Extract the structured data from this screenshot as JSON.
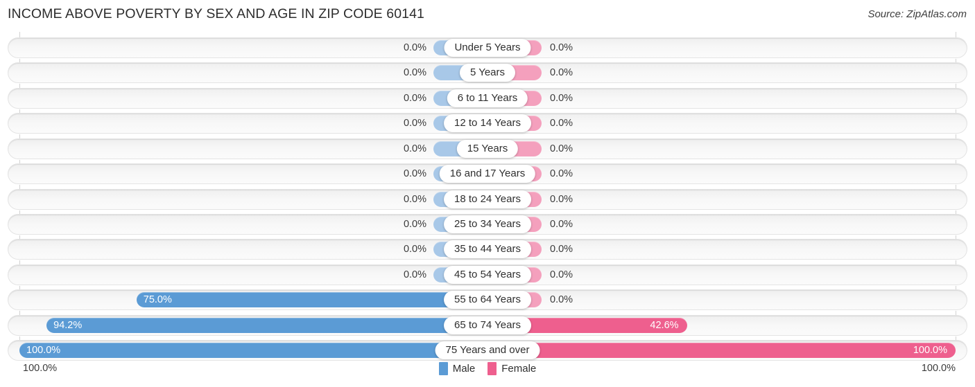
{
  "header": {
    "title": "INCOME ABOVE POVERTY BY SEX AND AGE IN ZIP CODE 60141",
    "source": "Source: ZipAtlas.com"
  },
  "colors": {
    "male": "#5b9bd5",
    "female": "#ee5f8e",
    "male_zero": "#a8c8e8",
    "female_zero": "#f4a0bd",
    "track": "#f7f7f7",
    "gridline": "#d2d2d2"
  },
  "axis": {
    "left_end": "100.0%",
    "right_end": "100.0%",
    "max": 100
  },
  "legend": [
    {
      "label": "Male",
      "color": "#5b9bd5"
    },
    {
      "label": "Female",
      "color": "#ee5f8e"
    }
  ],
  "chart_data": {
    "type": "bar",
    "title": "INCOME ABOVE POVERTY BY SEX AND AGE IN ZIP CODE 60141",
    "subtitle": "Source: ZipAtlas.com",
    "orientation": "horizontal-diverging",
    "xlabel": "",
    "ylabel": "",
    "xlim": [
      0,
      100
    ],
    "grid": true,
    "legend_position": "bottom-center",
    "categories": [
      "Under 5 Years",
      "5 Years",
      "6 to 11 Years",
      "12 to 14 Years",
      "15 Years",
      "16 and 17 Years",
      "18 to 24 Years",
      "25 to 34 Years",
      "35 to 44 Years",
      "45 to 54 Years",
      "55 to 64 Years",
      "65 to 74 Years",
      "75 Years and over"
    ],
    "series": [
      {
        "name": "Male",
        "color": "#5b9bd5",
        "values": [
          0.0,
          0.0,
          0.0,
          0.0,
          0.0,
          0.0,
          0.0,
          0.0,
          0.0,
          0.0,
          75.0,
          94.2,
          100.0
        ],
        "labels": [
          "0.0%",
          "0.0%",
          "0.0%",
          "0.0%",
          "0.0%",
          "0.0%",
          "0.0%",
          "0.0%",
          "0.0%",
          "0.0%",
          "75.0%",
          "94.2%",
          "100.0%"
        ]
      },
      {
        "name": "Female",
        "color": "#ee5f8e",
        "values": [
          0.0,
          0.0,
          0.0,
          0.0,
          0.0,
          0.0,
          0.0,
          0.0,
          0.0,
          0.0,
          0.0,
          42.6,
          100.0
        ],
        "labels": [
          "0.0%",
          "0.0%",
          "0.0%",
          "0.0%",
          "0.0%",
          "0.0%",
          "0.0%",
          "0.0%",
          "0.0%",
          "0.0%",
          "0.0%",
          "42.6%",
          "100.0%"
        ]
      }
    ]
  }
}
